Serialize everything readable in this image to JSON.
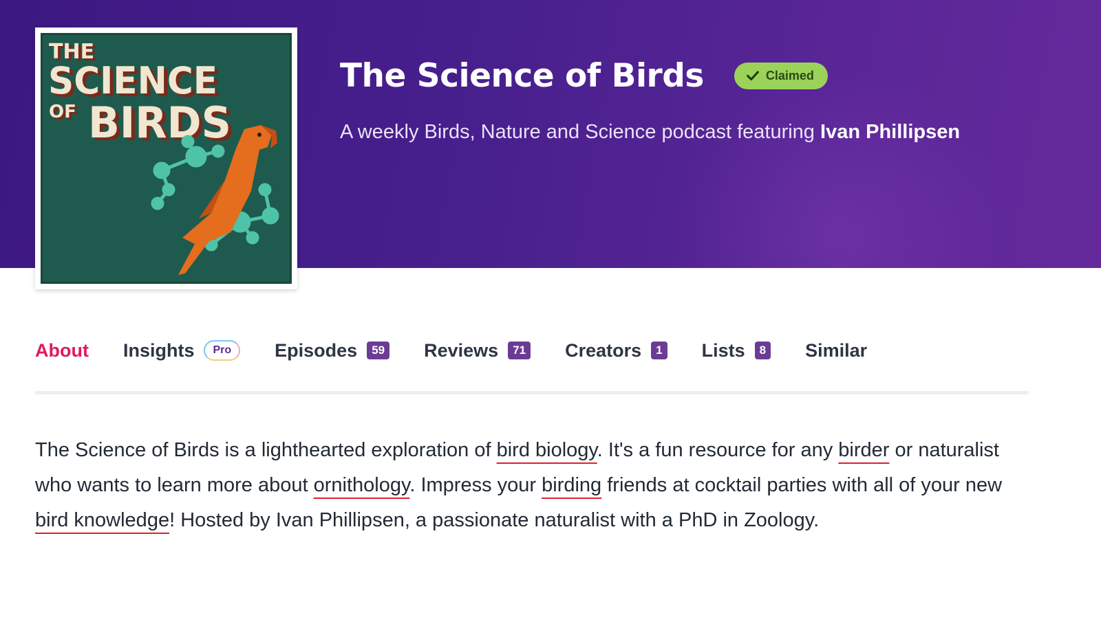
{
  "podcast": {
    "title": "The Science of Birds",
    "claimed_label": "Claimed",
    "subtitle_prefix": "A weekly Birds, Nature and Science podcast featuring",
    "host": "Ivan Phillipsen",
    "artwork": {
      "line1": "THE",
      "line2": "SCIENCE",
      "line3a": "OF",
      "line3b": "BIRDS"
    }
  },
  "tabs": [
    {
      "label": "About",
      "active": true
    },
    {
      "label": "Insights",
      "badge": "Pro"
    },
    {
      "label": "Episodes",
      "count": "59"
    },
    {
      "label": "Reviews",
      "count": "71"
    },
    {
      "label": "Creators",
      "count": "1"
    },
    {
      "label": "Lists",
      "count": "8"
    },
    {
      "label": "Similar"
    }
  ],
  "about": {
    "s1": "The Science of Birds is a lighthearted exploration of ",
    "k1": "bird biology",
    "s2": ". It's a fun resource for any ",
    "k2": "birder",
    "s3": " or naturalist who wants to learn more about ",
    "k3": "ornithology",
    "s4": ". Impress your ",
    "k4": "birding",
    "s5": " friends at cocktail parties with all of your new ",
    "k5": "bird knowledge",
    "s6": "! Hosted by Ivan Phillipsen, a passionate naturalist with a PhD in Zoology."
  },
  "colors": {
    "hero": "#48208e",
    "claimed": "#9bd35a",
    "active_tab": "#e3195b",
    "count_badge": "#6b3c94",
    "keyword_underline": "#d8222a",
    "artwork_bg": "#1f5a4e",
    "parrot": "#e46d1e",
    "molecule": "#4fc3a8"
  },
  "icons": {
    "claimed": "check-icon"
  }
}
